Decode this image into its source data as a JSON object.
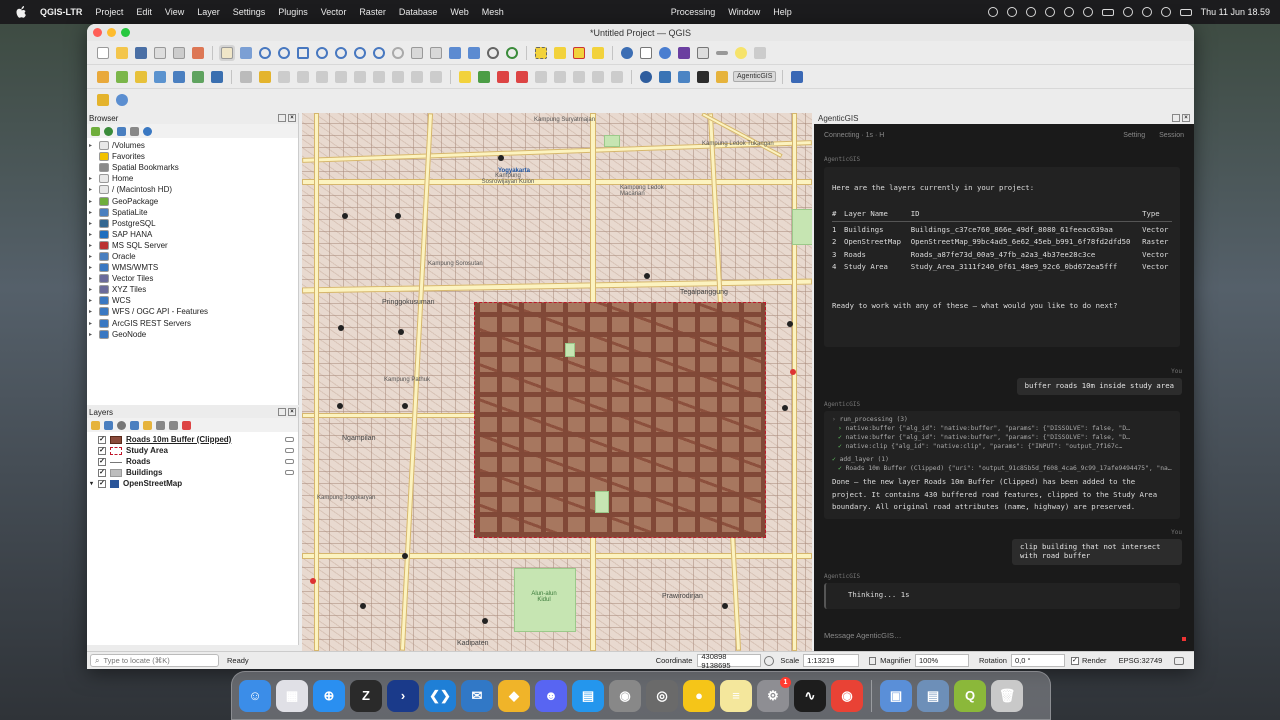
{
  "menubar": {
    "app": "QGIS-LTR",
    "items": [
      "Project",
      "Edit",
      "View",
      "Layer",
      "Settings",
      "Plugins",
      "Vector",
      "Raster",
      "Database",
      "Web",
      "Mesh"
    ],
    "right_items": [
      "Processing",
      "Window",
      "Help"
    ],
    "clock": "Thu 11 Jun  18.59"
  },
  "window": {
    "title": "*Untitled Project — QGIS",
    "plugin_tag": "AgenticGIS"
  },
  "browser": {
    "title": "Browser",
    "items": [
      {
        "label": "/Volumes",
        "icon": "folder-icon",
        "color": "#e8e8e8"
      },
      {
        "label": "Favorites",
        "icon": "star-icon",
        "color": "#f2c200"
      },
      {
        "label": "Spatial Bookmarks",
        "icon": "bookmark-icon",
        "color": "#8a8a8a"
      },
      {
        "label": "Home",
        "icon": "folder-icon",
        "color": "#e8e8e8"
      },
      {
        "label": "/ (Macintosh HD)",
        "icon": "folder-icon",
        "color": "#e8e8e8"
      },
      {
        "label": "GeoPackage",
        "icon": "geopackage-icon",
        "color": "#6fae3b"
      },
      {
        "label": "SpatiaLite",
        "icon": "spatialite-icon",
        "color": "#4a7fbf"
      },
      {
        "label": "PostgreSQL",
        "icon": "postgresql-icon",
        "color": "#336791"
      },
      {
        "label": "SAP HANA",
        "icon": "sap-hana-icon",
        "color": "#1f6fbf"
      },
      {
        "label": "MS SQL Server",
        "icon": "mssql-icon",
        "color": "#b33"
      },
      {
        "label": "Oracle",
        "icon": "oracle-icon",
        "color": "#4a7fbf"
      },
      {
        "label": "WMS/WMTS",
        "icon": "globe-icon",
        "color": "#3a78c2"
      },
      {
        "label": "Vector Tiles",
        "icon": "vector-tiles-icon",
        "color": "#6b6b9b"
      },
      {
        "label": "XYZ Tiles",
        "icon": "xyz-tiles-icon",
        "color": "#6b6b9b"
      },
      {
        "label": "WCS",
        "icon": "globe-icon",
        "color": "#3a78c2"
      },
      {
        "label": "WFS / OGC API - Features",
        "icon": "globe-icon",
        "color": "#3a78c2"
      },
      {
        "label": "ArcGIS REST Servers",
        "icon": "globe-icon",
        "color": "#3a78c2"
      },
      {
        "label": "GeoNode",
        "icon": "geonode-icon",
        "color": "#3a78c2"
      }
    ]
  },
  "layers": {
    "title": "Layers",
    "items": [
      {
        "name": "Roads 10m Buffer (Clipped)",
        "color": "#8a4a3a"
      },
      {
        "name": "Study Area",
        "color": "#ffffff"
      },
      {
        "name": "Roads",
        "color": "#777777"
      },
      {
        "name": "Buildings",
        "color": "#bdbdbd"
      },
      {
        "name": "OpenStreetMap",
        "color": "#2a5599"
      }
    ]
  },
  "map": {
    "labels": [
      "Yogyakarta",
      "Kampung Sosrowijayan Kulon",
      "Kampung Ledok Macanan",
      "Pringgokusuman",
      "Kampung Pathuk",
      "Kampung Sorosutan",
      "Ngampilan",
      "Kampung Suryatmajan",
      "Kampung Ledok Tukangan",
      "Tegalpanggung",
      "Kampung Jogokaryan",
      "Prawirodirjan",
      "Kadipaten",
      "Alun-alun Kidul"
    ]
  },
  "agent": {
    "panel_title": "AgenticGIS",
    "status": "Connecting · 1s · H",
    "settings_label": "Setting",
    "session_label": "Session",
    "assistant_name": "AgenticGIS",
    "user_name": "You",
    "msg1_intro": "Here are the layers currently in your project:",
    "table_header": [
      "#",
      "Layer Name",
      "ID",
      "Type"
    ],
    "table_rows": [
      [
        "1",
        "Buildings",
        "Buildings_c37ce760_866e_49df_8080_61feeac639aa",
        "Vector"
      ],
      [
        "2",
        "OpenStreetMap",
        "OpenStreetMap_99bc4ad5_6e62_45eb_b991_6f78fd2dfd50",
        "Raster"
      ],
      [
        "3",
        "Roads",
        "Roads_a87fe73d_00a9_47fb_a2a3_4b37ee28c3ce",
        "Vector"
      ],
      [
        "4",
        "Study Area",
        "Study_Area_3111f240_0f61_48e9_92c6_0bd672ea5fff",
        "Vector"
      ]
    ],
    "msg1_outro": "Ready to work with any of these — what would you like to do next?",
    "user_msg1": "buffer roads 10m inside study area",
    "tool_group1": "run_processing (3)",
    "tool_lines": [
      "native:buffer {\"alg_id\": \"native:buffer\", \"params\": {\"DISSOLVE\": false, \"D…",
      "native:buffer {\"alg_id\": \"native:buffer\", \"params\": {\"DISSOLVE\": false, \"D…",
      "native:clip {\"alg_id\": \"native:clip\", \"params\": {\"INPUT\": \"output_7f167c…"
    ],
    "tool_group2": "add_layer (1)",
    "tool_line2": "Roads 10m Buffer (Clipped) {\"uri\": \"output_91c85b5d_f608_4ca6_9c99_17afe9494475\", \"na…",
    "done_text": "Done — the new layer Roads 10m Buffer (Clipped) has been added to the project. It contains 430 buffered road features, clipped to the Study Area boundary. All original road attributes (name, highway) are preserved.",
    "user_msg2": "clip building that not intersect with road buffer",
    "thinking": "Thinking... 1s",
    "input_placeholder": "Message AgenticGIS…"
  },
  "statusbar": {
    "locate_placeholder": "Type to locate (⌘K)",
    "ready": "Ready",
    "coordinate_label": "Coordinate",
    "coordinate": "430898 9138695",
    "scale_label": "Scale",
    "scale": "1:13219",
    "magnifier_label": "Magnifier",
    "magnifier": "100%",
    "rotation_label": "Rotation",
    "rotation": "0,0 °",
    "render_label": "Render",
    "crs": "EPSG:32749"
  },
  "dock": {
    "apps": [
      {
        "name": "finder-icon",
        "glyph": "☺",
        "color": "#3b8de8"
      },
      {
        "name": "launchpad-icon",
        "glyph": "▦",
        "color": "#e0e0e6"
      },
      {
        "name": "safari-icon",
        "glyph": "⊕",
        "color": "#2a8ff0"
      },
      {
        "name": "zed-icon",
        "glyph": "Z",
        "color": "#2a2a2a"
      },
      {
        "name": "terminal-icon",
        "glyph": "›",
        "color": "#1a3a8a"
      },
      {
        "name": "vscode-icon",
        "glyph": "❮❯",
        "color": "#1f7fd6"
      },
      {
        "name": "mail-app-icon",
        "glyph": "✉",
        "color": "#3178c6"
      },
      {
        "name": "pgadmin-icon",
        "glyph": "◆",
        "color": "#f0b429"
      },
      {
        "name": "discord-icon",
        "glyph": "☻",
        "color": "#5865f2"
      },
      {
        "name": "docker-icon",
        "glyph": "▤",
        "color": "#2496ed"
      },
      {
        "name": "elephant-icon",
        "glyph": "◉",
        "color": "#888"
      },
      {
        "name": "disk-utility-icon",
        "glyph": "◎",
        "color": "#6a6a6a"
      },
      {
        "name": "duck-icon",
        "glyph": "●",
        "color": "#f5c518"
      },
      {
        "name": "notes-icon",
        "glyph": "≡",
        "color": "#f4e79c"
      },
      {
        "name": "system-settings-icon",
        "glyph": "⚙",
        "color": "#8e8e93",
        "badge": "1"
      },
      {
        "name": "activity-monitor-icon",
        "glyph": "∿",
        "color": "#1d1d1d"
      },
      {
        "name": "chrome-icon",
        "glyph": "◉",
        "color": "#e94235"
      },
      {
        "name": "finder-window-icon",
        "glyph": "▣",
        "color": "#5a8fd8"
      },
      {
        "name": "mailbox-icon",
        "glyph": "▤",
        "color": "#6d8fb8"
      },
      {
        "name": "qgis-icon",
        "glyph": "Q",
        "color": "#8bb83a"
      },
      {
        "name": "trash-icon",
        "glyph": "🗑",
        "color": "#c9c9c9"
      }
    ]
  }
}
